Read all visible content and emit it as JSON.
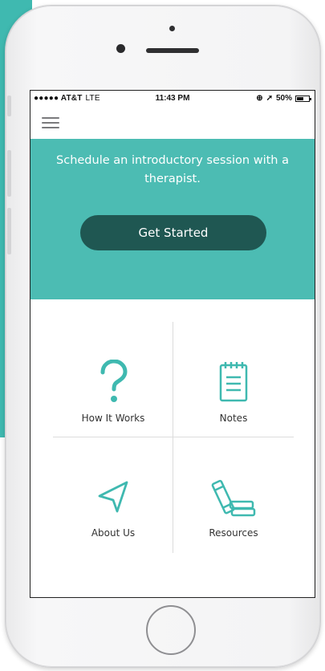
{
  "status_bar": {
    "carrier": "●●●●● AT&T",
    "network": "LTE",
    "time": "11:43 PM",
    "battery_text": "50%",
    "icons": [
      "alarm-icon",
      "location-arrow-icon",
      "battery-icon"
    ]
  },
  "nav": {
    "menu_icon": "hamburger-menu-icon"
  },
  "hero": {
    "text": "Schedule an introductory session with a therapist.",
    "cta_label": "Get Started"
  },
  "tiles": [
    {
      "label": "How It Works",
      "icon": "question-mark-icon"
    },
    {
      "label": "Notes",
      "icon": "notepad-icon"
    },
    {
      "label": "About Us",
      "icon": "navigation-arrow-icon"
    },
    {
      "label": "Resources",
      "icon": "books-icon"
    }
  ],
  "colors": {
    "accent": "#4cbcb3",
    "button": "#1f5752",
    "icon": "#3fb9b0",
    "text": "#333333"
  }
}
